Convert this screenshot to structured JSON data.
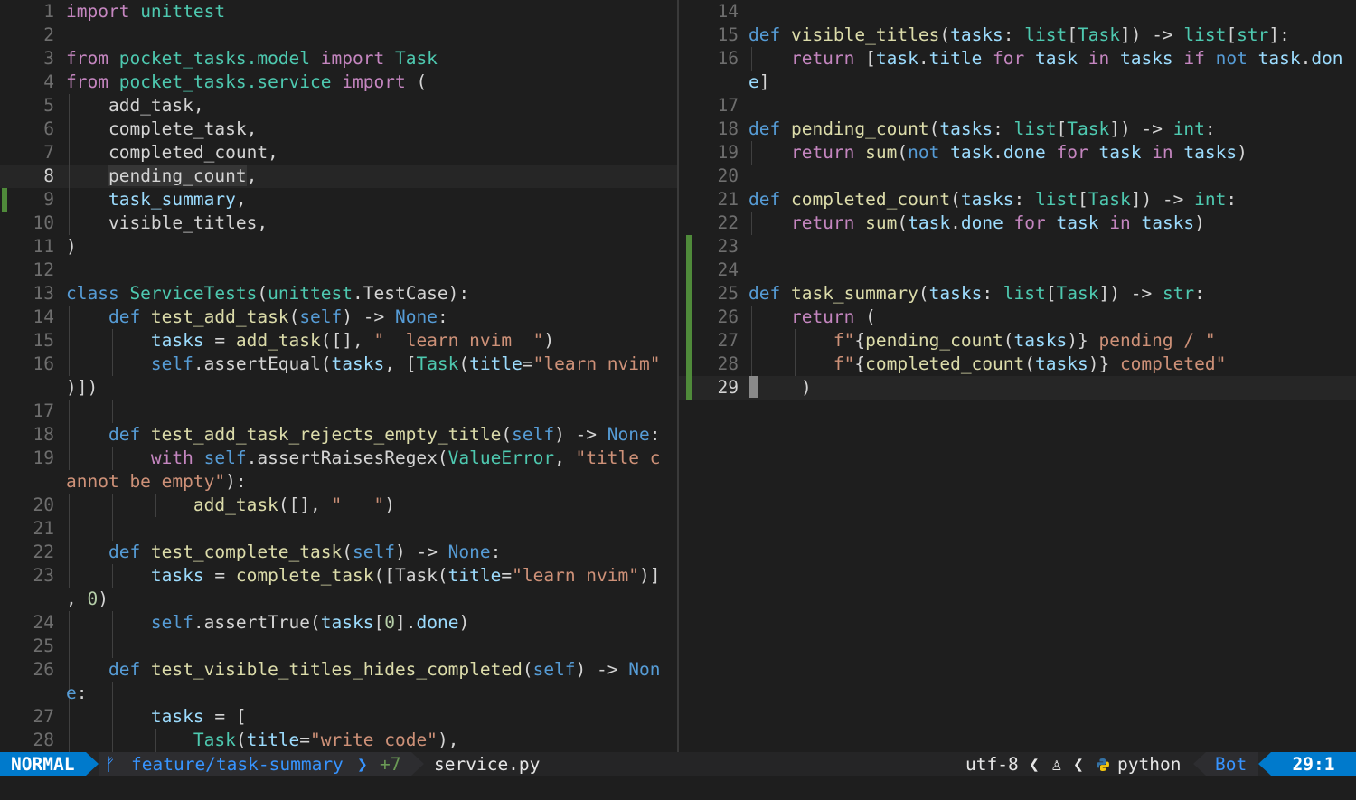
{
  "left_pane": {
    "lines": [
      {
        "n": "1",
        "segs": [
          [
            "k",
            "import"
          ],
          [
            "",
            ""
          ],
          [
            "c",
            " unittest"
          ]
        ]
      },
      {
        "n": "2",
        "segs": []
      },
      {
        "n": "3",
        "segs": [
          [
            "k",
            "from"
          ],
          [
            "c",
            " pocket_tasks.model"
          ],
          [
            "k",
            " import"
          ],
          [
            "c",
            " Task"
          ]
        ]
      },
      {
        "n": "4",
        "segs": [
          [
            "k",
            "from"
          ],
          [
            "c",
            " pocket_tasks.service"
          ],
          [
            "k",
            " import"
          ],
          [
            "",
            " ("
          ]
        ]
      },
      {
        "n": "5",
        "segs": [
          [
            "",
            "    add_task,"
          ]
        ],
        "guides": [
          1
        ]
      },
      {
        "n": "6",
        "segs": [
          [
            "",
            "    complete_task,"
          ]
        ],
        "guides": [
          1
        ]
      },
      {
        "n": "7",
        "segs": [
          [
            "",
            "    completed_count,"
          ]
        ],
        "guides": [
          1
        ]
      },
      {
        "n": "8",
        "segs": [
          [
            "",
            "    "
          ],
          [
            "hl",
            "pending_count"
          ],
          [
            "",
            ","
          ]
        ],
        "guides": [
          1
        ],
        "current": true
      },
      {
        "n": "9",
        "segs": [
          [
            "p",
            "    task_summary"
          ],
          [
            "",
            ","
          ]
        ],
        "guides": [
          1
        ],
        "sign": true
      },
      {
        "n": "10",
        "segs": [
          [
            "",
            "    visible_titles,"
          ]
        ],
        "guides": [
          1
        ]
      },
      {
        "n": "11",
        "segs": [
          [
            "",
            ")"
          ]
        ]
      },
      {
        "n": "12",
        "segs": []
      },
      {
        "n": "13",
        "segs": [
          [
            "d",
            "class"
          ],
          [
            "c",
            " ServiceTests"
          ],
          [
            "",
            "("
          ],
          [
            "c",
            "unittest"
          ],
          [
            "",
            ".TestCase"
          ],
          [
            "",
            "):"
          ]
        ]
      },
      {
        "n": "14",
        "segs": [
          [
            "d",
            "    def"
          ],
          [
            "f",
            " test_add_task"
          ],
          [
            "",
            "("
          ],
          [
            "d",
            "self"
          ],
          [
            "",
            ") -> "
          ],
          [
            "d",
            "None"
          ],
          [
            "",
            ":"
          ]
        ],
        "guides": [
          1
        ]
      },
      {
        "n": "15",
        "segs": [
          [
            "p",
            "        tasks"
          ],
          [
            "",
            " = "
          ],
          [
            "f",
            "add_task"
          ],
          [
            "",
            "([], "
          ],
          [
            "s",
            "\"  learn nvim  \""
          ],
          [
            "",
            ")"
          ]
        ],
        "guides": [
          1,
          2
        ]
      },
      {
        "n": "16",
        "segs": [
          [
            "d",
            "        self"
          ],
          [
            "",
            ".assertEqual("
          ],
          [
            "p",
            "tasks"
          ],
          [
            "",
            ", ["
          ],
          [
            "c",
            "Task"
          ],
          [
            "",
            "("
          ],
          [
            "p",
            "title"
          ],
          [
            "",
            "="
          ],
          [
            "s",
            "\"learn nvim\""
          ]
        ],
        "guides": [
          1,
          2
        ]
      },
      {
        "n": "",
        "segs": [
          [
            "",
            ")])"
          ]
        ]
      },
      {
        "n": "17",
        "segs": [],
        "guides": [
          1,
          2
        ]
      },
      {
        "n": "18",
        "segs": [
          [
            "d",
            "    def"
          ],
          [
            "f",
            " test_add_task_rejects_empty_title"
          ],
          [
            "",
            "("
          ],
          [
            "d",
            "self"
          ],
          [
            "",
            ") -> "
          ],
          [
            "d",
            "None"
          ],
          [
            "",
            ":"
          ]
        ],
        "guides": [
          1
        ]
      },
      {
        "n": "19",
        "segs": [
          [
            "k",
            "        with"
          ],
          [
            "d",
            " self"
          ],
          [
            "",
            ".assertRaisesRegex("
          ],
          [
            "c",
            "ValueError"
          ],
          [
            "",
            ", "
          ],
          [
            "s",
            "\"title c"
          ]
        ],
        "guides": [
          1,
          2
        ]
      },
      {
        "n": "",
        "segs": [
          [
            "s",
            "annot be empty\""
          ],
          [
            "",
            "):"
          ]
        ]
      },
      {
        "n": "20",
        "segs": [
          [
            "f",
            "            add_task"
          ],
          [
            "",
            "([], "
          ],
          [
            "s",
            "\"   \""
          ],
          [
            "",
            ")"
          ]
        ],
        "guides": [
          1,
          2,
          3
        ]
      },
      {
        "n": "21",
        "segs": [],
        "guides": [
          1,
          2
        ]
      },
      {
        "n": "22",
        "segs": [
          [
            "d",
            "    def"
          ],
          [
            "f",
            " test_complete_task"
          ],
          [
            "",
            "("
          ],
          [
            "d",
            "self"
          ],
          [
            "",
            ") -> "
          ],
          [
            "d",
            "None"
          ],
          [
            "",
            ":"
          ]
        ],
        "guides": [
          1
        ]
      },
      {
        "n": "23",
        "segs": [
          [
            "p",
            "        tasks"
          ],
          [
            "",
            " = "
          ],
          [
            "f",
            "complete_task"
          ],
          [
            "",
            "([Task("
          ],
          [
            "p",
            "title"
          ],
          [
            "",
            "="
          ],
          [
            "s",
            "\"learn nvim\""
          ],
          [
            "",
            ")]"
          ]
        ],
        "guides": [
          1,
          2
        ]
      },
      {
        "n": "",
        "segs": [
          [
            "",
            ", "
          ],
          [
            "n",
            "0"
          ],
          [
            "",
            ")"
          ]
        ]
      },
      {
        "n": "24",
        "segs": [
          [
            "d",
            "        self"
          ],
          [
            "",
            ".assertTrue("
          ],
          [
            "p",
            "tasks"
          ],
          [
            "",
            "["
          ],
          [
            "n",
            "0"
          ],
          [
            "",
            "]."
          ],
          [
            "p",
            "done"
          ],
          [
            "",
            ")"
          ]
        ],
        "guides": [
          1,
          2
        ]
      },
      {
        "n": "25",
        "segs": [],
        "guides": [
          1,
          2
        ]
      },
      {
        "n": "26",
        "segs": [
          [
            "d",
            "    def"
          ],
          [
            "f",
            " test_visible_titles_hides_completed"
          ],
          [
            "",
            "("
          ],
          [
            "d",
            "self"
          ],
          [
            "",
            ") -> "
          ],
          [
            "d",
            "Non"
          ]
        ],
        "guides": [
          1
        ]
      },
      {
        "n": "",
        "segs": [
          [
            "d",
            "e"
          ],
          [
            "",
            ":"
          ]
        ],
        "guides": [
          1,
          2
        ]
      },
      {
        "n": "27",
        "segs": [
          [
            "p",
            "        tasks"
          ],
          [
            "",
            " = ["
          ]
        ],
        "guides": [
          1,
          2
        ]
      },
      {
        "n": "28",
        "segs": [
          [
            "c",
            "            Task"
          ],
          [
            "",
            "("
          ],
          [
            "p",
            "title"
          ],
          [
            "",
            "="
          ],
          [
            "s",
            "\"write code\""
          ],
          [
            "",
            "),"
          ]
        ],
        "guides": [
          1,
          2,
          3
        ]
      }
    ]
  },
  "right_pane": {
    "lines": [
      {
        "n": "14",
        "segs": []
      },
      {
        "n": "15",
        "segs": [
          [
            "d",
            "def"
          ],
          [
            "f",
            " visible_titles"
          ],
          [
            "",
            "("
          ],
          [
            "p",
            "tasks"
          ],
          [
            "",
            ": "
          ],
          [
            "c",
            "list"
          ],
          [
            "",
            "["
          ],
          [
            "c",
            "Task"
          ],
          [
            "",
            "]) -> "
          ],
          [
            "c",
            "list"
          ],
          [
            "",
            "["
          ],
          [
            "c",
            "str"
          ],
          [
            "",
            "]:"
          ]
        ]
      },
      {
        "n": "16",
        "segs": [
          [
            "k",
            "    return"
          ],
          [
            "",
            " ["
          ],
          [
            "p",
            "task"
          ],
          [
            "",
            "."
          ],
          [
            "p",
            "title"
          ],
          [
            "k",
            " for"
          ],
          [
            "p",
            " task"
          ],
          [
            "k",
            " in"
          ],
          [
            "p",
            " tasks"
          ],
          [
            "k",
            " if"
          ],
          [
            "d",
            " not"
          ],
          [
            "p",
            " task"
          ],
          [
            "",
            "."
          ],
          [
            "p",
            "don"
          ]
        ],
        "guides": [
          1
        ]
      },
      {
        "n": "",
        "segs": [
          [
            "p",
            "e"
          ],
          [
            "",
            "]"
          ]
        ]
      },
      {
        "n": "17",
        "segs": []
      },
      {
        "n": "18",
        "segs": [
          [
            "d",
            "def"
          ],
          [
            "f",
            " pending_count"
          ],
          [
            "",
            "("
          ],
          [
            "p",
            "tasks"
          ],
          [
            "",
            ": "
          ],
          [
            "c",
            "list"
          ],
          [
            "",
            "["
          ],
          [
            "c",
            "Task"
          ],
          [
            "",
            "]) -> "
          ],
          [
            "c",
            "int"
          ],
          [
            "",
            ":"
          ]
        ]
      },
      {
        "n": "19",
        "segs": [
          [
            "k",
            "    return"
          ],
          [
            "f",
            " sum"
          ],
          [
            "",
            "("
          ],
          [
            "d",
            "not"
          ],
          [
            "p",
            " task"
          ],
          [
            "",
            "."
          ],
          [
            "p",
            "done"
          ],
          [
            "k",
            " for"
          ],
          [
            "p",
            " task"
          ],
          [
            "k",
            " in"
          ],
          [
            "p",
            " tasks"
          ],
          [
            "",
            ")"
          ]
        ],
        "guides": [
          1
        ]
      },
      {
        "n": "20",
        "segs": []
      },
      {
        "n": "21",
        "segs": [
          [
            "d",
            "def"
          ],
          [
            "f",
            " completed_count"
          ],
          [
            "",
            "("
          ],
          [
            "p",
            "tasks"
          ],
          [
            "",
            ": "
          ],
          [
            "c",
            "list"
          ],
          [
            "",
            "["
          ],
          [
            "c",
            "Task"
          ],
          [
            "",
            "]) -> "
          ],
          [
            "c",
            "int"
          ],
          [
            "",
            ":"
          ]
        ]
      },
      {
        "n": "22",
        "segs": [
          [
            "k",
            "    return"
          ],
          [
            "f",
            " sum"
          ],
          [
            "",
            "("
          ],
          [
            "p",
            "task"
          ],
          [
            "",
            "."
          ],
          [
            "p",
            "done"
          ],
          [
            "k",
            " for"
          ],
          [
            "p",
            " task"
          ],
          [
            "k",
            " in"
          ],
          [
            "p",
            " tasks"
          ],
          [
            "",
            ")"
          ]
        ],
        "guides": [
          1
        ]
      },
      {
        "n": "23",
        "segs": [],
        "sign": true
      },
      {
        "n": "24",
        "segs": [],
        "sign": true
      },
      {
        "n": "25",
        "segs": [
          [
            "d",
            "def"
          ],
          [
            "f",
            " task_summary"
          ],
          [
            "",
            "("
          ],
          [
            "p",
            "tasks"
          ],
          [
            "",
            ": "
          ],
          [
            "c",
            "list"
          ],
          [
            "",
            "["
          ],
          [
            "c",
            "Task"
          ],
          [
            "",
            "]) -> "
          ],
          [
            "c",
            "str"
          ],
          [
            "",
            ":"
          ]
        ],
        "sign": true
      },
      {
        "n": "26",
        "segs": [
          [
            "k",
            "    return"
          ],
          [
            "",
            " ("
          ]
        ],
        "guides": [
          1
        ],
        "sign": true
      },
      {
        "n": "27",
        "segs": [
          [
            "s",
            "        f\""
          ],
          [
            "",
            "{"
          ],
          [
            "f",
            "pending_count"
          ],
          [
            "",
            "("
          ],
          [
            "p",
            "tasks"
          ],
          [
            "",
            ")}"
          ],
          [
            "s",
            " pending / \""
          ]
        ],
        "guides": [
          1,
          2
        ],
        "sign": true
      },
      {
        "n": "28",
        "segs": [
          [
            "s",
            "        f\""
          ],
          [
            "",
            "{"
          ],
          [
            "f",
            "completed_count"
          ],
          [
            "",
            "("
          ],
          [
            "p",
            "tasks"
          ],
          [
            "",
            ")}"
          ],
          [
            "s",
            " completed\""
          ]
        ],
        "guides": [
          1,
          2
        ],
        "sign": true
      },
      {
        "n": "29",
        "segs": [
          [
            "cursor",
            ""
          ],
          [
            "",
            "    )"
          ]
        ],
        "current": true,
        "sign": true
      }
    ]
  },
  "status": {
    "mode": "NORMAL",
    "branch_icon": "ᚠ",
    "branch": "feature/task-summary",
    "branch_sep": "❯",
    "git_added": "+7",
    "filename": "service.py",
    "encoding": "utf-8",
    "sep": "❮",
    "os_icon": "♙",
    "filetype": "python",
    "scroll": "Bot",
    "position": "29:1"
  },
  "colors": {
    "accent": "#007acc",
    "git_sign": "#4f8a3a"
  }
}
